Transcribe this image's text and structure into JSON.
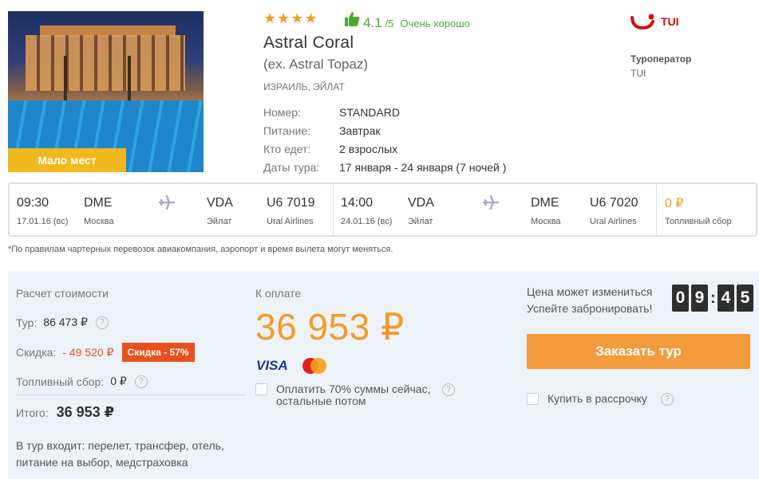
{
  "hotel": {
    "stars": "★★★★",
    "badge": "Мало мест",
    "rating": "4.1",
    "rating_max": "/5",
    "rating_text": "Очень хорошо",
    "name": "Astral Coral",
    "alt_name": "(ex. Astral Topaz)",
    "location": "ИЗРАИЛЬ, ЭЙЛАТ",
    "details": [
      {
        "key": "Номер:",
        "value": "STANDARD"
      },
      {
        "key": "Питание:",
        "value": "Завтрак"
      },
      {
        "key": "Кто едет:",
        "value": "2 взрослых"
      },
      {
        "key": "Даты тура:",
        "value": "17 января - 24 января (7 ночей )"
      }
    ]
  },
  "operator": {
    "logo_text": "TUI",
    "label": "Туроператор",
    "name": "TUI",
    "brand_color": "#d40e14"
  },
  "flights": {
    "outbound": {
      "time": "09:30",
      "date": "17.01.16 (вс)",
      "from_code": "DME",
      "from_city": "Москва",
      "to_code": "VDA",
      "to_city": "Эйлат",
      "flight_no": "U6 7019",
      "airline": "Ural Airlines"
    },
    "return": {
      "time": "14:00",
      "date": "24.01.16 (вс)",
      "from_code": "VDA",
      "from_city": "Эйлат",
      "to_code": "DME",
      "to_city": "Москва",
      "flight_no": "U6 7020",
      "airline": "Ural Airlines"
    },
    "fuel_value": "0 ₽",
    "fuel_label": "Топливный сбор"
  },
  "note": "*По правилам чартерных перевозок авиакомпания, аэропорт и время вылета могут меняться.",
  "calc": {
    "title": "Расчет стоимости",
    "tour_label": "Тур:",
    "tour_value": "86 473 ₽",
    "discount_label": "Скидка:",
    "discount_value": "- 49 520 ₽",
    "discount_badge": "Скидка - 57%",
    "fuel_label": "Топливный сбор:",
    "fuel_value": "0 ₽",
    "total_label": "Итого:",
    "total_value": "36 953 ₽",
    "includes": "В тур входит: перелет, трансфер, отель, питание на выбор, медстраховка"
  },
  "payment": {
    "title": "К оплате",
    "amount": "36 953 ₽",
    "visa": "VISA",
    "partial_label": "Оплатить 70% суммы сейчас, остальные потом"
  },
  "booking": {
    "price_change_1": "Цена может измениться",
    "price_change_2": "Успейте забронировать!",
    "timer": [
      "0",
      "9",
      "4",
      "5"
    ],
    "order_button": "Заказать тур",
    "installment_label": "Купить в рассрочку"
  },
  "colors": {
    "accent_orange": "#f39a3d",
    "rating_green": "#4aa832",
    "discount_red": "#e8501f",
    "badge_yellow": "#f2b81f"
  }
}
